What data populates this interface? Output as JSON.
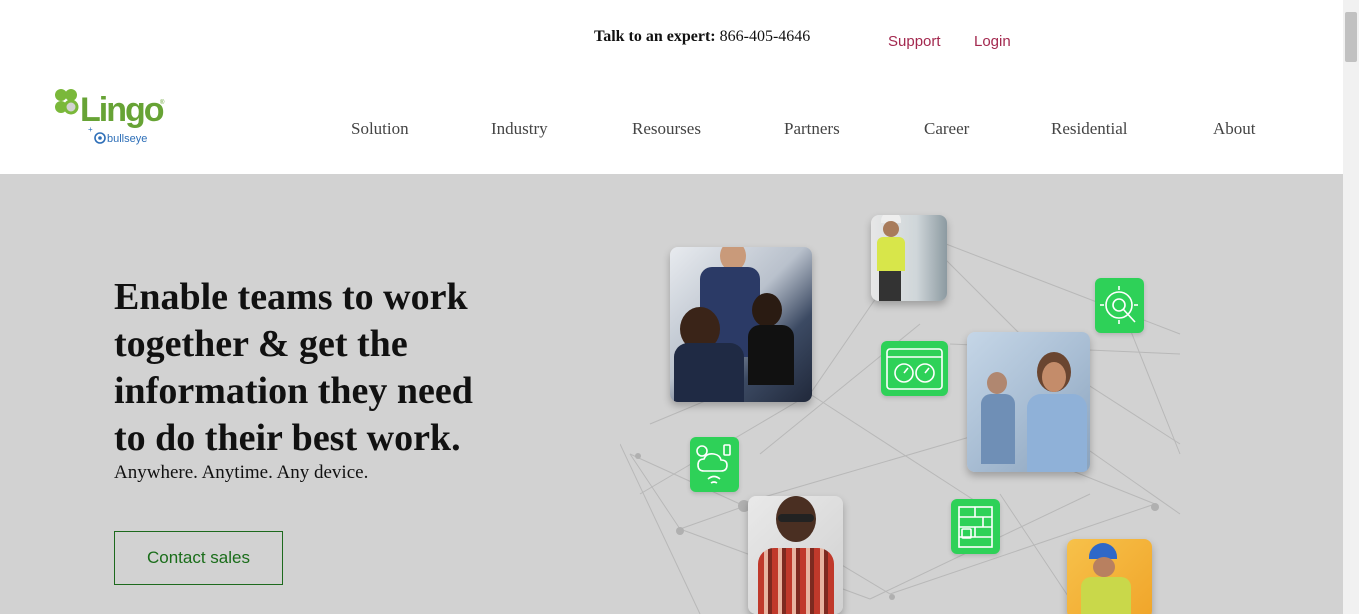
{
  "header": {
    "expert_label": "Talk to an expert:",
    "expert_phone": "866-405-4646",
    "support_label": "Support",
    "login_label": "Login",
    "logo_text": "Lingo",
    "logo_sub": "bullseye"
  },
  "nav": {
    "items": [
      {
        "label": "Solution"
      },
      {
        "label": "Industry"
      },
      {
        "label": "Resourses"
      },
      {
        "label": "Partners"
      },
      {
        "label": "Career"
      },
      {
        "label": "Residential"
      },
      {
        "label": "About"
      }
    ]
  },
  "hero": {
    "headline": "Enable teams to work together & get the information they need to do their best work.",
    "subheadline": "Anywhere. Anytime. Any device.",
    "cta_label": "Contact sales"
  },
  "colors": {
    "accent_link": "#a3294f",
    "brand_green": "#2ed158",
    "hero_bg": "#d2d2d2",
    "cta_border": "#1d6a1d"
  }
}
